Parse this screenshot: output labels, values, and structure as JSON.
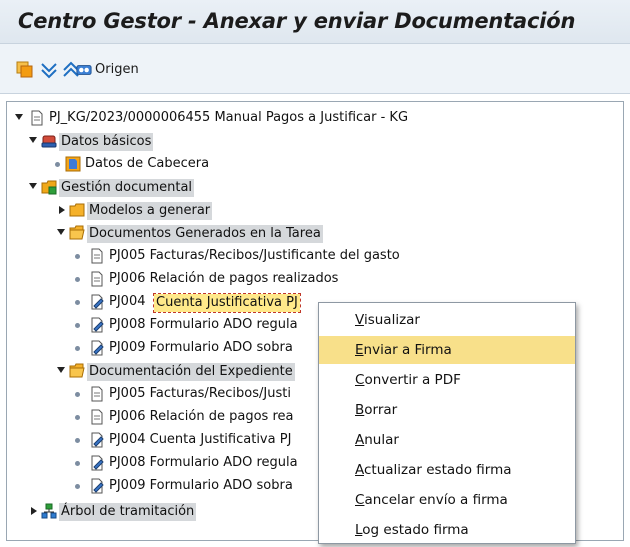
{
  "window": {
    "title": "Centro Gestor - Anexar y enviar Documentación"
  },
  "toolbar": {
    "origin_label": "Origen"
  },
  "tree": {
    "root": "PJ_KG/2023/0000006455 Manual Pagos a Justificar - KG",
    "basic": {
      "label": "Datos básicos",
      "child": "Datos de Cabecera"
    },
    "docs": {
      "label": "Gestión documental",
      "models": "Modelos a generar",
      "generated": {
        "label": "Documentos Generados en la Tarea",
        "items": [
          "PJ005 Facturas/Recibos/Justificante del gasto",
          "PJ006 Relación de pagos realizados",
          "PJ004 ",
          "PJ008 Formulario ADO regula",
          "PJ009 Formulario ADO sobra"
        ],
        "selected_text": "Cuenta Justificativa PJ"
      },
      "file": {
        "label": "Documentación del Expediente",
        "items": [
          "PJ005 Facturas/Recibos/Justi",
          "PJ006 Relación de pagos rea",
          "PJ004 Cuenta Justificativa PJ",
          "PJ008 Formulario ADO regula",
          "PJ009 Formulario ADO sobra"
        ]
      }
    },
    "process": "Árbol de tramitación"
  },
  "context_menu": {
    "items": [
      {
        "first": "V",
        "rest": "isualizar"
      },
      {
        "first": "E",
        "rest": "nviar a Firma"
      },
      {
        "first": "C",
        "rest": "onvertir a PDF"
      },
      {
        "first": "B",
        "rest": "orrar"
      },
      {
        "first": "A",
        "rest": "nular"
      },
      {
        "first": "A",
        "rest": "ctualizar estado firma"
      },
      {
        "first": "C",
        "rest": "ancelar envío a firma"
      },
      {
        "first": "L",
        "rest": "og estado firma"
      }
    ],
    "active_index": 1
  },
  "colors": {
    "highlight": "#f8e08a",
    "selection": "#ffe98a",
    "folder": "#f0a818"
  }
}
